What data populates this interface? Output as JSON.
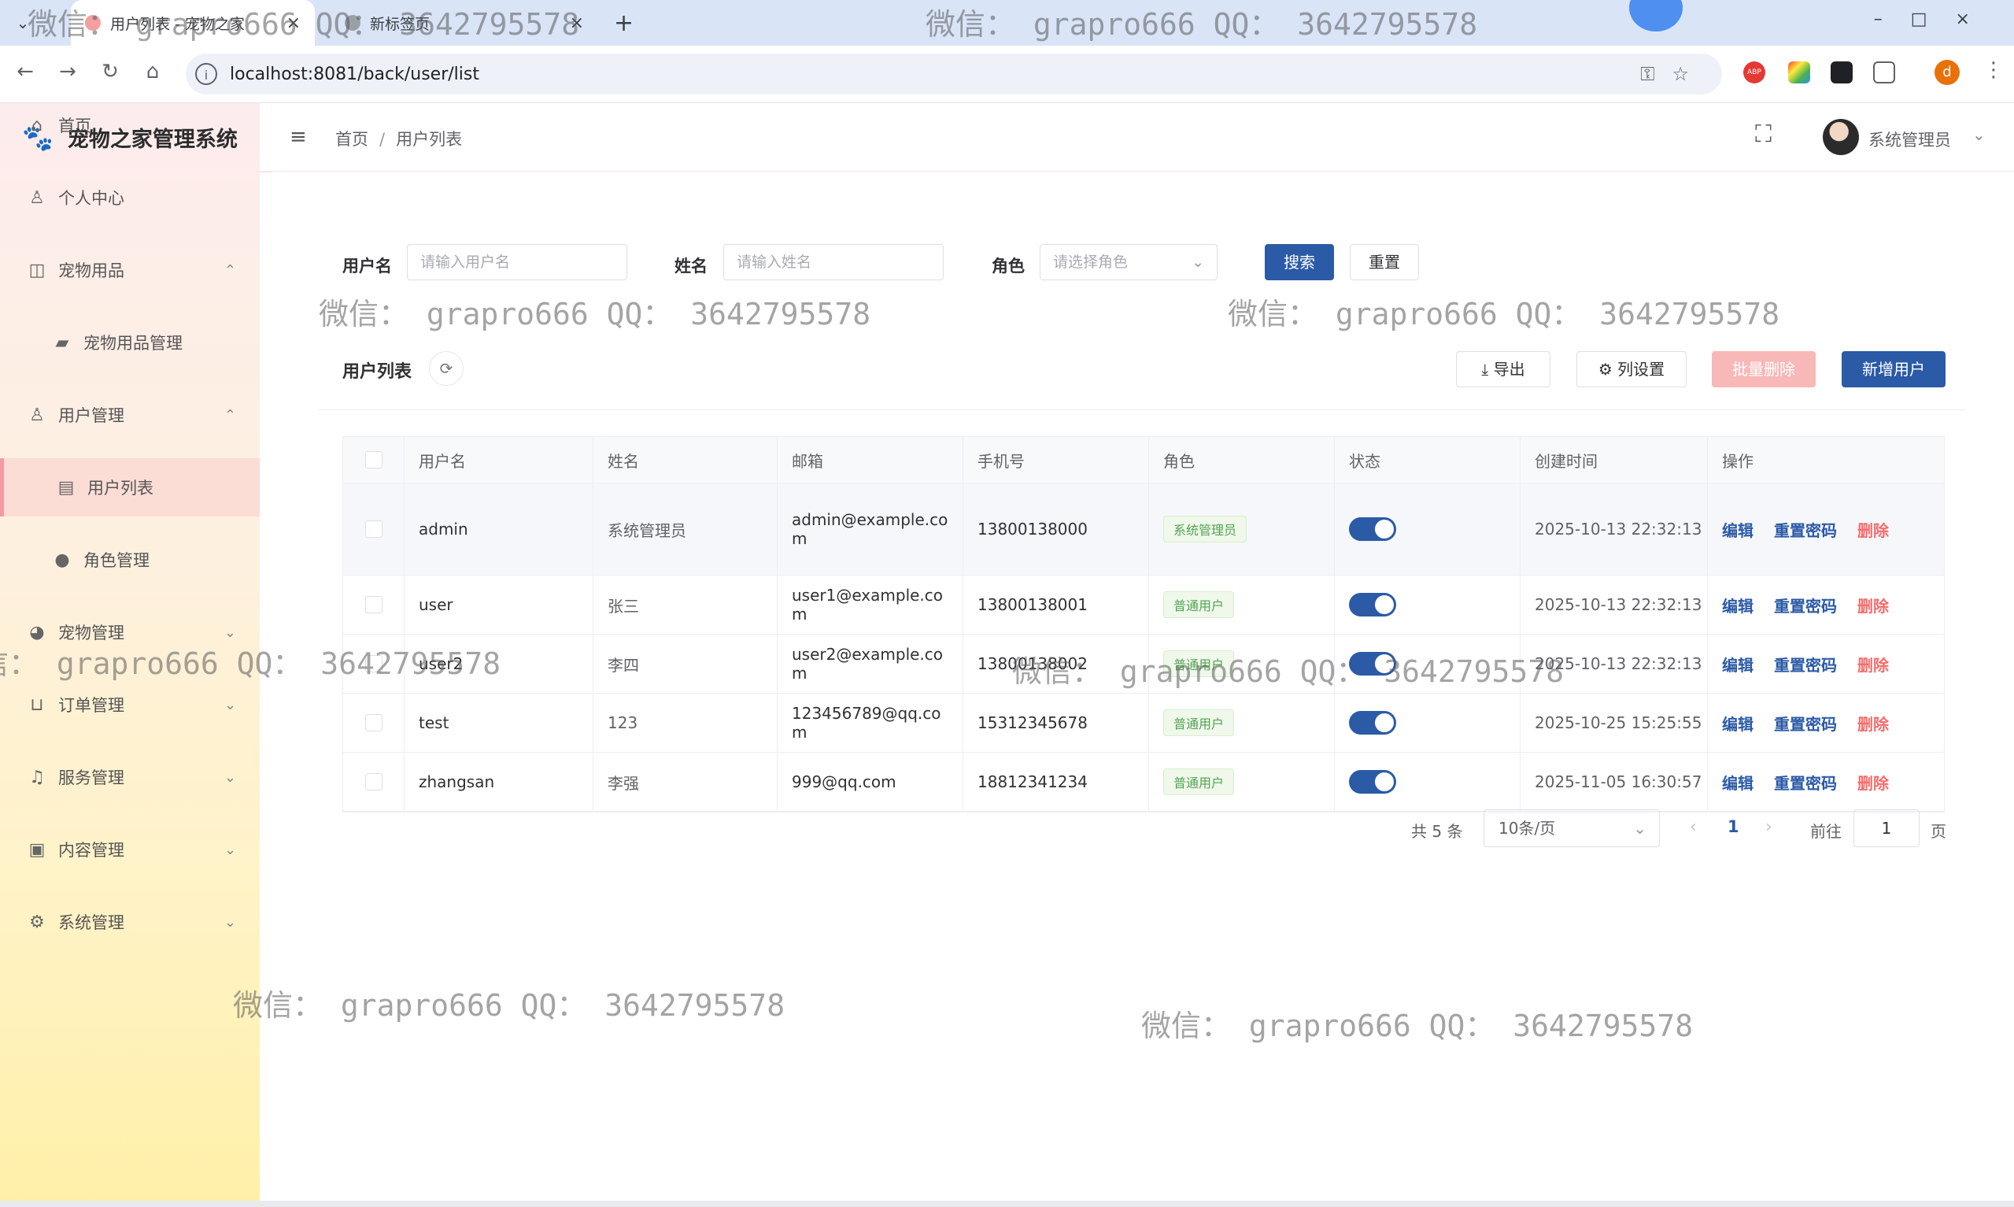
{
  "browser": {
    "tabs": [
      {
        "title": "用户列表 - 宠物之家",
        "active": true
      },
      {
        "title": "新标签页",
        "active": false
      }
    ],
    "url": "localhost:8081/back/user/list",
    "profile_initial": "d"
  },
  "app": {
    "name": "宠物之家管理系统",
    "sidebar": [
      {
        "label": "首页",
        "icon": "home-icon",
        "level": "top"
      },
      {
        "label": "个人中心",
        "icon": "user-icon",
        "level": "top"
      },
      {
        "label": "宠物用品",
        "icon": "bag-icon",
        "level": "top",
        "chevron": "^"
      },
      {
        "label": "宠物用品管理",
        "icon": "shopping-bag-icon",
        "level": "sub"
      },
      {
        "label": "用户管理",
        "icon": "user-icon",
        "level": "top",
        "chevron": "^"
      },
      {
        "label": "用户列表",
        "icon": "document-icon",
        "level": "sub",
        "active": true
      },
      {
        "label": "角色管理",
        "icon": "person-icon",
        "level": "sub"
      },
      {
        "label": "宠物管理",
        "icon": "pet-icon",
        "level": "top",
        "chevron": "v"
      },
      {
        "label": "订单管理",
        "icon": "cart-icon",
        "level": "top",
        "chevron": "v"
      },
      {
        "label": "服务管理",
        "icon": "headset-icon",
        "level": "top",
        "chevron": "v"
      },
      {
        "label": "内容管理",
        "icon": "content-icon",
        "level": "top",
        "chevron": "v"
      },
      {
        "label": "系统管理",
        "icon": "gear-icon",
        "level": "top",
        "chevron": "v"
      }
    ],
    "breadcrumb": [
      "首页",
      "用户列表"
    ],
    "user": {
      "name": "系统管理员"
    }
  },
  "search_form": {
    "username_label": "用户名",
    "username_placeholder": "请输入用户名",
    "name_label": "姓名",
    "name_placeholder": "请输入姓名",
    "role_label": "角色",
    "role_placeholder": "请选择角色",
    "search_button": "搜索",
    "reset_button": "重置"
  },
  "list": {
    "title": "用户列表",
    "export_button": "导出",
    "columns_button": "列设置",
    "batch_delete_button": "批量删除",
    "add_button": "新增用户",
    "columns": [
      "用户名",
      "姓名",
      "邮箱",
      "手机号",
      "角色",
      "状态",
      "创建时间",
      "操作"
    ],
    "rows": [
      {
        "username": "admin",
        "name": "系统管理员",
        "email": "admin@example.com",
        "phone": "13800138000",
        "role": "系统管理员",
        "status": true,
        "created": "2025-10-13 22:32:13"
      },
      {
        "username": "user",
        "name": "张三",
        "email": "user1@example.com",
        "phone": "13800138001",
        "role": "普通用户",
        "status": true,
        "created": "2025-10-13 22:32:13"
      },
      {
        "username": "user2",
        "name": "李四",
        "email": "user2@example.com",
        "phone": "13800138002",
        "role": "普通用户",
        "status": true,
        "created": "2025-10-13 22:32:13"
      },
      {
        "username": "test",
        "name": "123",
        "email": "123456789@qq.com",
        "phone": "15312345678",
        "role": "普通用户",
        "status": true,
        "created": "2025-10-25 15:25:55"
      },
      {
        "username": "zhangsan",
        "name": "李强",
        "email": "999@qq.com",
        "phone": "18812341234",
        "role": "普通用户",
        "status": true,
        "created": "2025-11-05 16:30:57"
      }
    ],
    "actions": {
      "edit": "编辑",
      "reset_password": "重置密码",
      "delete": "删除"
    }
  },
  "pagination": {
    "total_text": "共 5 条",
    "page_size": "10条/页",
    "current_page": "1",
    "goto_label": "前往",
    "goto_value": "1",
    "page_suffix": "页"
  },
  "watermark": "微信： grapro666 QQ： 3642795578",
  "colors": {
    "primary": "#2b5aa6",
    "danger": "#f56c6c",
    "success_tag": "#52a352"
  }
}
